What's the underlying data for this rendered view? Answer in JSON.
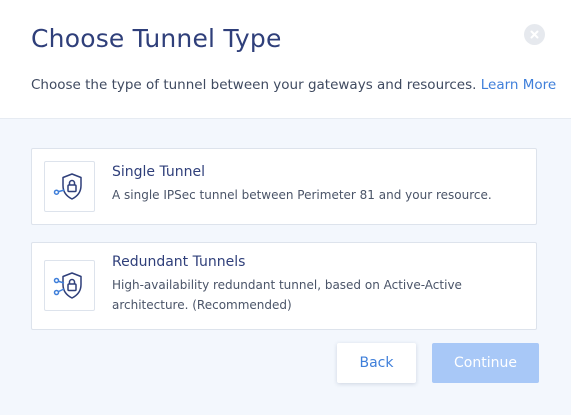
{
  "dialog": {
    "title": "Choose Tunnel Type",
    "subtitle": "Choose the type of tunnel between your gateways and resources.",
    "learn_more": "Learn More",
    "close_icon": "close-icon"
  },
  "options": [
    {
      "title": "Single Tunnel",
      "description": "A single IPSec tunnel between Perimeter 81 and your resource.",
      "icon": "shield-lock-single-icon"
    },
    {
      "title": "Redundant Tunnels",
      "description": "High-availability redundant tunnel, based on Active-Active architecture. (Recommended)",
      "icon": "shield-lock-redundant-icon"
    }
  ],
  "actions": {
    "back_label": "Back",
    "continue_label": "Continue",
    "continue_disabled": true
  },
  "colors": {
    "title": "#2f3f7a",
    "link": "#3f7fda",
    "body_bg": "#f3f7fd",
    "continue_bg_disabled": "#a8c8f7"
  }
}
